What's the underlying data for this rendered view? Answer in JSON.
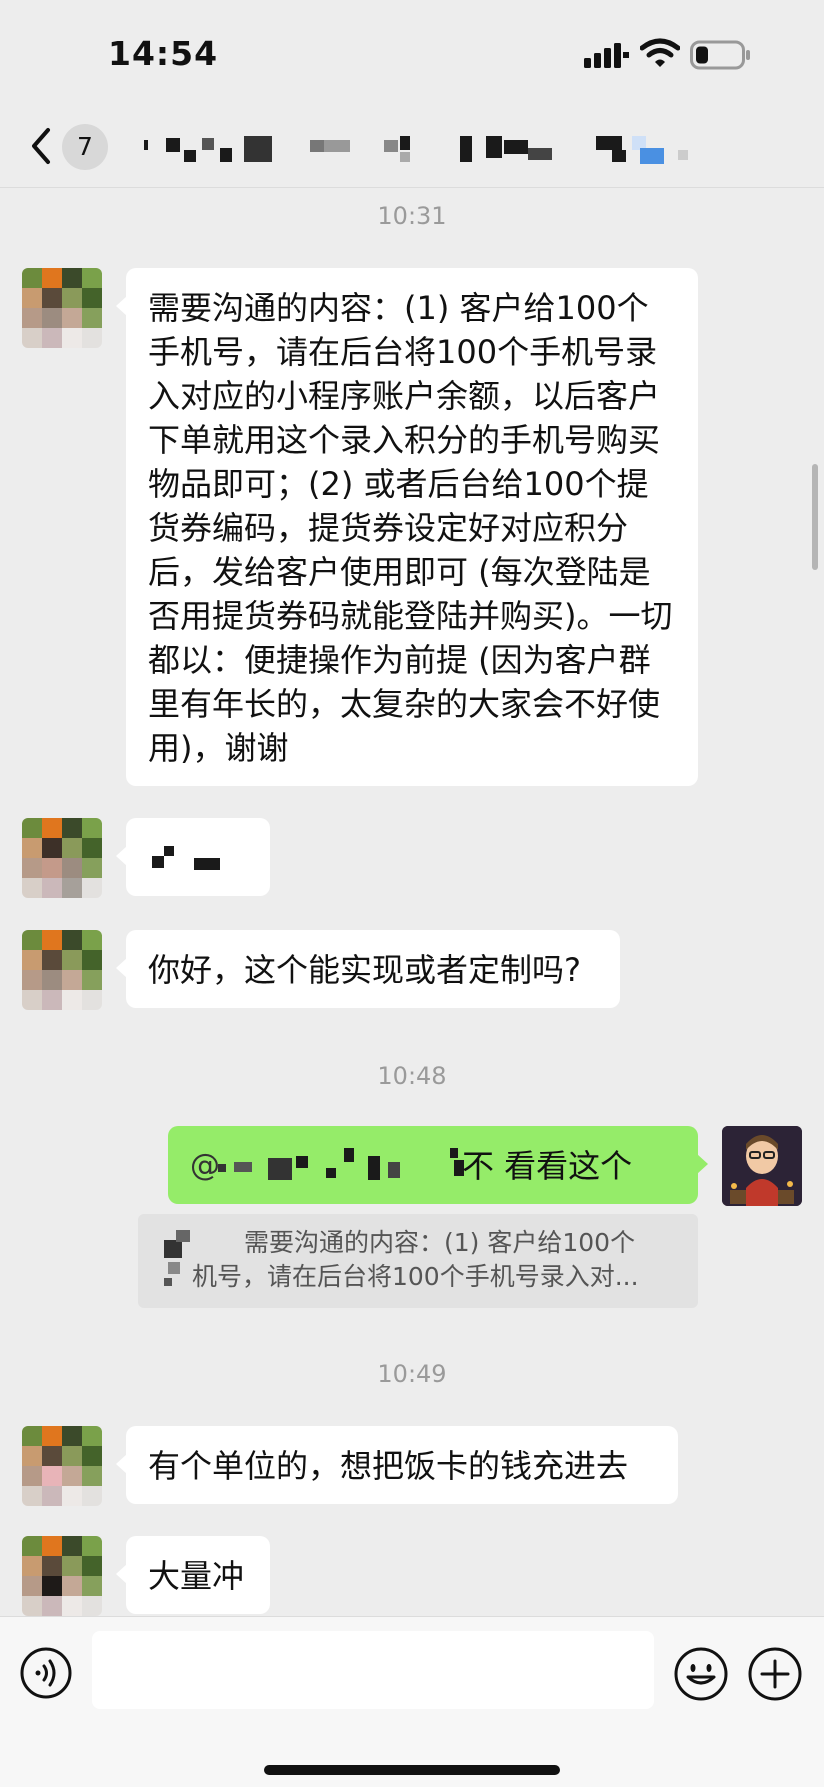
{
  "status_bar": {
    "time": "14:54",
    "battery_level": 0.2
  },
  "nav": {
    "unread_count": "7"
  },
  "messages": [
    {
      "timestamp": "10:31"
    },
    {
      "text": "需要沟通的内容：(1) 客户给100个手机号，请在后台将100个手机号录入对应的小程序账户余额，以后客户下单就用这个录入积分的手机号购买物品即可；(2) 或者后台给100个提货券编码，提货券设定好对应积分后，发给客户使用即可 (每次登陆是否用提货券码就能登陆并购买)。一切都以：便捷操作为前提 (因为客户群里有年长的，太复杂的大家会不好使用)，谢谢"
    },
    {
      "text": "你好，这个能实现或者定制吗?"
    },
    {
      "timestamp": "10:48"
    },
    {
      "text_suffix": "不 看看这个"
    },
    {
      "quote_line1": "需要沟通的内容：(1) 客户给100个",
      "quote_line2": "机号，请在后台将100个手机号录入对..."
    },
    {
      "timestamp": "10:49"
    },
    {
      "text": "有个单位的，想把饭卡的钱充进去"
    },
    {
      "text": "大量冲"
    }
  ],
  "colors": {
    "background": "#ededed",
    "bubble_self": "#95ec69",
    "bubble_other": "#ffffff"
  }
}
